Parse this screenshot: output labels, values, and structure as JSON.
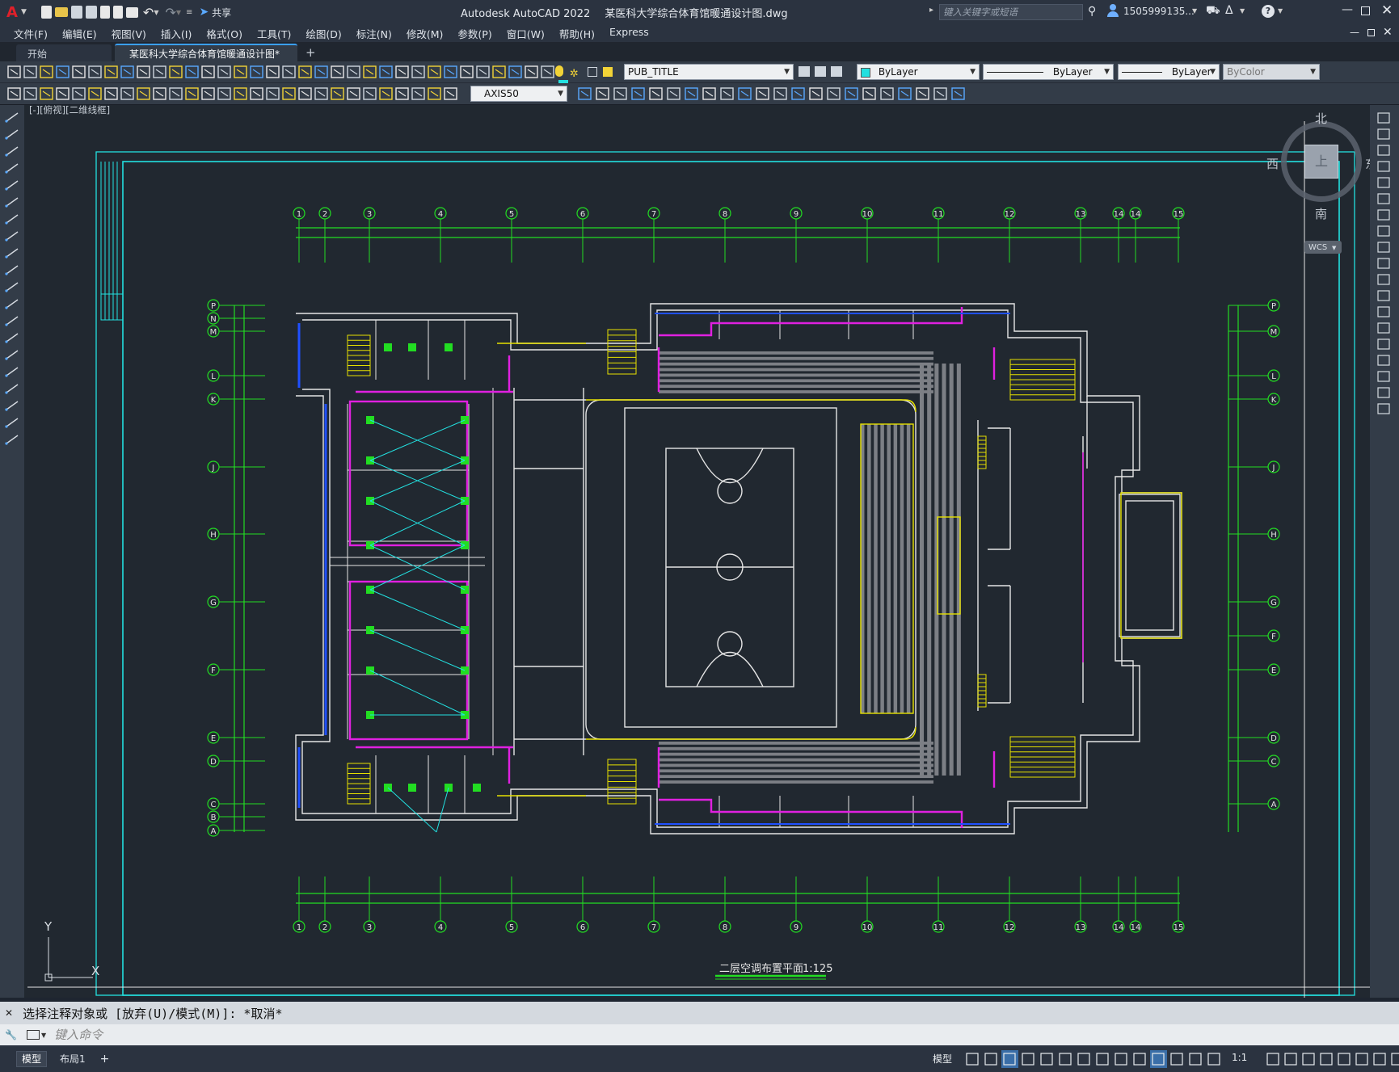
{
  "window": {
    "app_title": "Autodesk AutoCAD 2022",
    "file_title": "某医科大学综合体育馆暖通设计图.dwg",
    "share_label": "共享",
    "search_placeholder": "键入关键字或短语",
    "user": "1505999135...",
    "logo": "A"
  },
  "menu": [
    "文件(F)",
    "编辑(E)",
    "视图(V)",
    "插入(I)",
    "格式(O)",
    "工具(T)",
    "绘图(D)",
    "标注(N)",
    "修改(M)",
    "参数(P)",
    "窗口(W)",
    "帮助(H)",
    "Express"
  ],
  "tabs": [
    {
      "label": "开始",
      "active": false
    },
    {
      "label": "某医科大学综合体育馆暖通设计图*",
      "active": true
    }
  ],
  "toolbar": {
    "layer": "PUB_TITLE",
    "color": "ByLayer",
    "linetype": "ByLayer",
    "lineweight": "ByLayer",
    "plotstyle": "ByColor",
    "dimstyle": "AXIS50"
  },
  "viewport": {
    "label": "[-][俯视][二维线框]",
    "compass": {
      "north": "北",
      "south": "南",
      "east": "东",
      "west": "西",
      "center": "上",
      "wcs": "WCS"
    },
    "drawing_title": "二层空调布置平面",
    "drawing_scale": "1:125",
    "axis_numbers": [
      "1",
      "2",
      "3",
      "4",
      "5",
      "6",
      "7",
      "8",
      "9",
      "10",
      "11",
      "12",
      "13",
      "14",
      "14",
      "15"
    ],
    "axis_letters_left": [
      "P",
      "N",
      "M",
      "L",
      "K",
      "J",
      "H",
      "G",
      "F",
      "E",
      "D",
      "C",
      "B",
      "A"
    ],
    "axis_letters_right": [
      "P",
      "M",
      "L",
      "K",
      "J",
      "H",
      "G",
      "F",
      "E",
      "D",
      "C",
      "A"
    ],
    "ucs_y": "Y",
    "ucs_x": "X"
  },
  "command": {
    "history": "选择注释对象或 [放弃(U)/模式(M)]: *取消*",
    "placeholder": "键入命令"
  },
  "status": {
    "tabs": [
      "模型",
      "布局1"
    ],
    "model_label": "模型",
    "scale": "1:1"
  },
  "colors": {
    "accent": "#3aa0ff",
    "drawing_bg": "#212830",
    "grid_green": "#22dd22",
    "wall_white": "#e6e6e6",
    "duct_magenta": "#e020e0",
    "cyan_frame": "#22e0e0",
    "yellow": "#e6e000"
  }
}
